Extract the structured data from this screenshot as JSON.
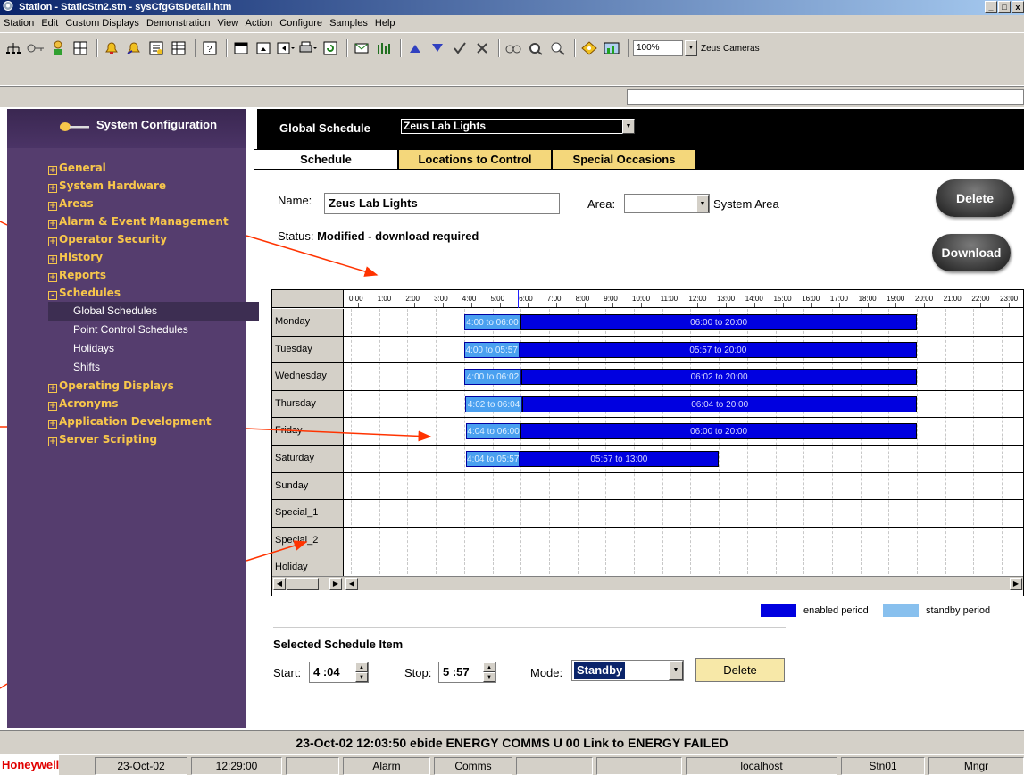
{
  "window": {
    "title": "Station - StaticStn2.stn - sysCfgGtsDetail.htm",
    "controls": [
      "_",
      "□",
      "x"
    ]
  },
  "menu": [
    "Station",
    "Edit",
    "Custom Displays",
    "Demonstration",
    "View",
    "Action",
    "Configure",
    "Samples",
    "Help"
  ],
  "toolbar": {
    "icons": [
      "network-icon",
      "key-icon",
      "operator-icon",
      "grid-icon",
      "alarm-bell-icon",
      "alarm-ack-icon",
      "report-icon",
      "table-icon",
      "help-icon",
      "display-icon",
      "display-up-icon",
      "back-icon",
      "print-icon",
      "refresh-icon",
      "message-icon",
      "trend-icon",
      "up-arrow-icon",
      "down-arrow-icon",
      "check-icon",
      "cross-icon",
      "glasses-icon",
      "binoculars-icon",
      "magnifier-icon",
      "diamond-icon",
      "chart-icon"
    ],
    "zoom": "100%",
    "camera_select": "Zeus Cameras"
  },
  "sidebar": {
    "title": "System Configuration",
    "items": [
      {
        "label": "General",
        "expand": "+"
      },
      {
        "label": "System Hardware",
        "expand": "+"
      },
      {
        "label": "Areas",
        "expand": "+"
      },
      {
        "label": "Alarm & Event Management",
        "expand": "+"
      },
      {
        "label": "Operator Security",
        "expand": "+"
      },
      {
        "label": "History",
        "expand": "+"
      },
      {
        "label": "Reports",
        "expand": "+"
      },
      {
        "label": "Schedules",
        "expand": "-"
      }
    ],
    "schedule_children": [
      "Global Schedules",
      "Point Control Schedules",
      "Holidays",
      "Shifts"
    ],
    "items_after": [
      {
        "label": "Operating Displays",
        "expand": "+"
      },
      {
        "label": "Acronyms",
        "expand": "+"
      },
      {
        "label": "Application Development",
        "expand": "+"
      },
      {
        "label": "Server Scripting",
        "expand": "+"
      }
    ]
  },
  "header": {
    "label": "Global Schedule",
    "selected": "Zeus Lab Lights"
  },
  "tabs": [
    "Schedule",
    "Locations to Control",
    "Special Occasions"
  ],
  "form": {
    "name_label": "Name:",
    "name_value": "Zeus Lab Lights",
    "area_label": "Area:",
    "area_value": "",
    "system_area": "System Area",
    "status_label": "Status:",
    "status_value": "Modified - download required",
    "delete_button": "Delete",
    "download_button": "Download"
  },
  "grid": {
    "hours": [
      "0:00",
      "1:00",
      "2:00",
      "3:00",
      "4:00",
      "5:00",
      "6:00",
      "7:00",
      "8:00",
      "9:00",
      "10:00",
      "11:00",
      "12:00",
      "13:00",
      "14:00",
      "15:00",
      "16:00",
      "17:00",
      "18:00",
      "19:00",
      "20:00",
      "21:00",
      "22:00",
      "23:00"
    ],
    "rows": [
      "Monday",
      "Tuesday",
      "Wednesday",
      "Thursday",
      "Friday",
      "Saturday",
      "Sunday",
      "Special_1",
      "Special_2",
      "Holiday"
    ],
    "periods": [
      {
        "day": "Monday",
        "standby": "4:00 to 06:00",
        "enabled": "06:00 to 20:00",
        "standby_start": 4.0,
        "standby_end": 6.0,
        "enabled_end": 20.0
      },
      {
        "day": "Tuesday",
        "standby": "4:00 to 05:57",
        "enabled": "05:57 to 20:00",
        "standby_start": 4.0,
        "standby_end": 5.95,
        "enabled_end": 20.0
      },
      {
        "day": "Wednesday",
        "standby": "4:00 to 06:02",
        "enabled": "06:02 to 20:00",
        "standby_start": 4.0,
        "standby_end": 6.03,
        "enabled_end": 20.0
      },
      {
        "day": "Thursday",
        "standby": "4:02 to 06:04",
        "enabled": "06:04 to 20:00",
        "standby_start": 4.03,
        "standby_end": 6.07,
        "enabled_end": 20.0
      },
      {
        "day": "Friday",
        "standby": "4:04 to 06:00",
        "enabled": "06:00 to 20:00",
        "standby_start": 4.07,
        "standby_end": 6.0,
        "enabled_end": 20.0
      },
      {
        "day": "Saturday",
        "standby": "4:04 to 05:57",
        "enabled": "05:57 to 13:00",
        "standby_start": 4.07,
        "standby_end": 5.95,
        "enabled_end": 13.0
      }
    ]
  },
  "legend": {
    "enabled": "enabled period",
    "standby": "standby period",
    "enabled_color": "#0000e0",
    "standby_color": "#4aa0f0"
  },
  "selected_item": {
    "title": "Selected Schedule Item",
    "start_label": "Start:",
    "start_value": "4 :04",
    "stop_label": "Stop:",
    "stop_value": "5 :57",
    "mode_label": "Mode:",
    "mode_value": "Standby",
    "delete_button": "Delete"
  },
  "message_bar": "23-Oct-02 12:03:50   ebide   ENERGY   COMMS   U 00   Link to ENERGY   FAILED",
  "statusbar": {
    "brand": "Honeywell",
    "date": "23-Oct-02",
    "time": "12:29:00",
    "alarm": "Alarm",
    "comms": "Comms",
    "host": "localhost",
    "station": "Stn01",
    "level": "Mngr"
  }
}
